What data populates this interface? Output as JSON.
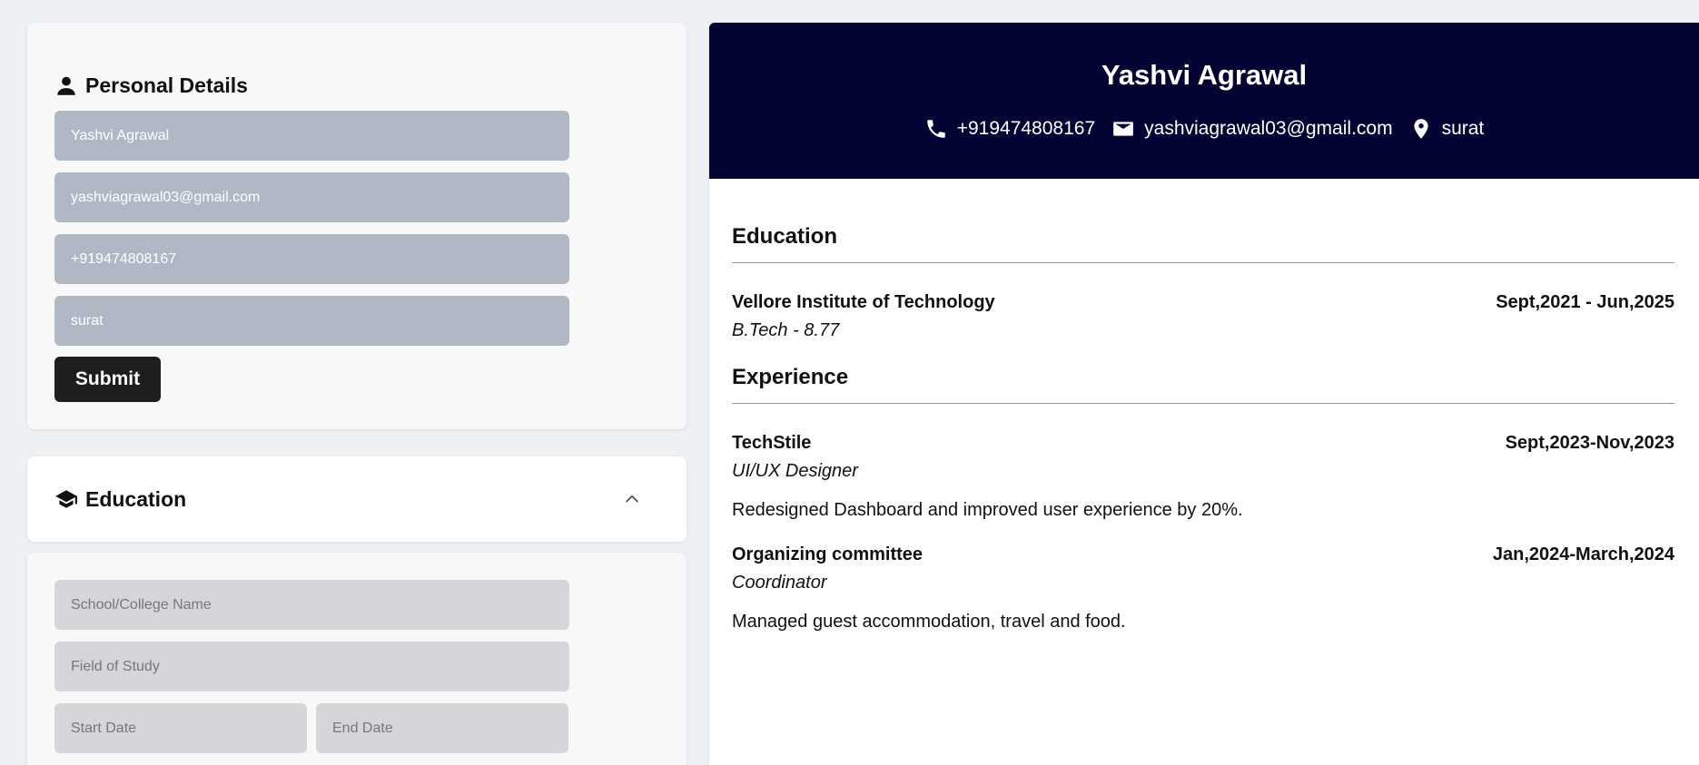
{
  "personal": {
    "title": "Personal Details",
    "name": "Yashvi Agrawal",
    "email": "yashviagrawal03@gmail.com",
    "phone": "+919474808167",
    "location": "surat",
    "submit_label": "Submit"
  },
  "education_section": {
    "title": "Education",
    "school_placeholder": "School/College Name",
    "field_placeholder": "Field of Study",
    "start_placeholder": "Start Date",
    "end_placeholder": "End Date"
  },
  "resume": {
    "name": "Yashvi Agrawal",
    "phone": "+919474808167",
    "email": "yashviagrawal03@gmail.com",
    "location": "surat",
    "education_title": "Education",
    "education": [
      {
        "institution": "Vellore Institute of Technology",
        "dates": "Sept,2021 - Jun,2025",
        "degree": "B.Tech - 8.77"
      }
    ],
    "experience_title": "Experience",
    "experience": [
      {
        "company": "TechStile",
        "dates": "Sept,2023-Nov,2023",
        "role": "UI/UX Designer",
        "description": "Redesigned Dashboard and improved user experience by 20%."
      },
      {
        "company": "Organizing committee",
        "dates": "Jan,2024-March,2024",
        "role": "Coordinator",
        "description": "Managed guest accommodation, travel and food."
      }
    ]
  },
  "colors": {
    "header_bg": "#020333",
    "filled_field": "#b0b8c6",
    "empty_field": "#d5d6da",
    "button": "#1e1e1e"
  }
}
